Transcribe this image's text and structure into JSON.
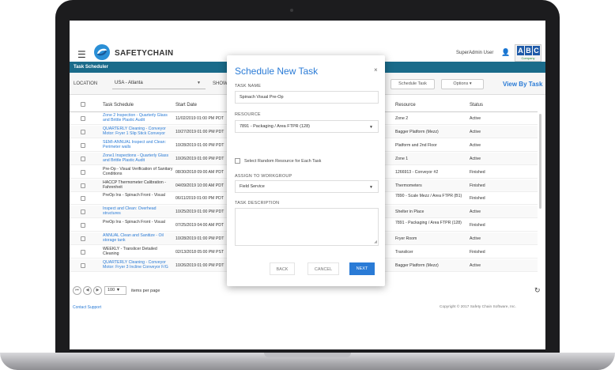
{
  "app": {
    "brand": "SAFETYCHAIN",
    "user_name": "SuperAdmin User",
    "abc_letters": [
      "A",
      "B",
      "C"
    ],
    "abc_sub": "Company",
    "section_title": "Task Scheduler"
  },
  "filters": {
    "location_label": "LOCATION",
    "location_value": "USA - Atlanta",
    "show_label": "SHOW",
    "schedule_task_label": "Schedule Task",
    "options_label": "Options",
    "view_by_task_label": "View By Task"
  },
  "table": {
    "headers": {
      "name": "Task Schedule",
      "date": "Start Date",
      "resource": "Resource",
      "status": "Status"
    },
    "rows": [
      {
        "name": "Zone 2 Inspection - Quarterly Glass and Brittle Plastic Audit",
        "link": true,
        "date": "11/02/2019 01:00 PM PDT",
        "resource": "Zone 2",
        "status": "Active"
      },
      {
        "name": "QUARTERLY Cleaning - Conveyor Motor: Fryer 1 Slip Stick Conveyor",
        "link": true,
        "date": "10/27/2019 01:00 PM PDT",
        "resource": "Bagger Platform (Mezz)",
        "status": "Active"
      },
      {
        "name": "SEMI-ANNUAL Inspect and Clean: Perimeter walls",
        "link": true,
        "date": "10/28/2019 01:00 PM PDT",
        "resource": "Platform and 2nd Floor",
        "status": "Active"
      },
      {
        "name": "Zone1 Inspections - Quarterly Glass and Brittle Plastic Audit",
        "link": true,
        "date": "10/26/2019 01:00 PM PDT",
        "resource": "Zone 1",
        "status": "Active"
      },
      {
        "name": "Pre-Op - Visual Verification of Sanitary Conditions",
        "link": false,
        "date": "08/30/2018 09:00 AM PDT",
        "resource": "1266913 - Conveyor #2",
        "status": "Finished"
      },
      {
        "name": "HACCP Thermometer Calibration - Fahrenheit",
        "link": false,
        "date": "04/09/2019 10:00 AM PDT",
        "resource": "Thermometers",
        "status": "Finished"
      },
      {
        "name": "PreOp Ins - Spinach Front - Visual",
        "link": false,
        "date": "06/11/2019 01:00 PM PDT",
        "resource": "7890 - Scale Mezz / Area FTPR (B1)",
        "status": "Finished"
      },
      {
        "name": "Inspect and Clean: Overhead structures",
        "link": true,
        "date": "10/25/2019 01:00 PM PDT",
        "resource": "Shelter in Place",
        "status": "Active"
      },
      {
        "name": "PreOp Ins - Spinach Front - Visual",
        "link": false,
        "date": "07/25/2019 04:00 AM PDT",
        "resource": "7891 - Packaging / Area FTPR (128)",
        "status": "Finished"
      },
      {
        "name": "ANNUAL Clean and Sanitize - Oil storage tank",
        "link": true,
        "date": "10/28/2019 01:00 PM PDT",
        "resource": "Fryer Room",
        "status": "Active"
      },
      {
        "name": "WEEKLY - Translicer Detailed Cleaning",
        "link": false,
        "date": "02/13/2018 05:00 PM PST",
        "resource": "Translicer",
        "status": "Finished"
      },
      {
        "name": "QUARTERLY Cleaning - Conveyor Motor: Fryer 3 Incline Conveyor F/G",
        "link": true,
        "date": "10/26/2019 01:00 PM PDT",
        "resource": "Bagger Platform (Mezz)",
        "status": "Active"
      }
    ]
  },
  "pager": {
    "first": "⏮",
    "prev": "◀",
    "next": "▶",
    "page_size": "100",
    "items_per_page": "items per page"
  },
  "footer": {
    "contact": "Contact Support",
    "copyright": "Copyright © 2017 Safety Chain Software, Inc."
  },
  "modal": {
    "title": "Schedule New Task",
    "close": "×",
    "task_name_label": "TASK NAME",
    "task_name_value": "Spinach Visual Pre-Op",
    "resource_label": "RESOURCE",
    "resource_value": "7891 - Packaging / Area FTPR (128)",
    "random_resource_label": "Select Random Resource for Each Task",
    "workgroup_label": "ASSIGN TO WORKGROUP",
    "workgroup_value": "Field Service",
    "description_label": "TASK DESCRIPTION",
    "back_label": "BACK",
    "cancel_label": "CANCEL",
    "next_label": "NEXT"
  },
  "colors": {
    "accent": "#2a7bd6",
    "header_bar": "#1a6b8a"
  }
}
